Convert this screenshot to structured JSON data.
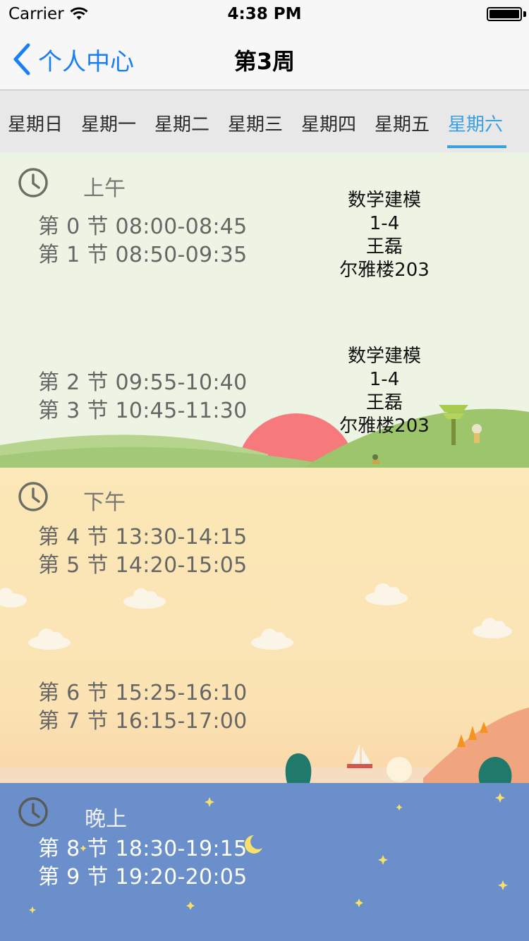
{
  "status_bar": {
    "carrier": "Carrier",
    "time": "4:38 PM",
    "battery_level": 1.0
  },
  "nav": {
    "back_label": "个人中心",
    "title": "第3周"
  },
  "day_tabs": [
    {
      "label": "星期日",
      "active": false
    },
    {
      "label": "星期一",
      "active": false
    },
    {
      "label": "星期二",
      "active": false
    },
    {
      "label": "星期三",
      "active": false
    },
    {
      "label": "星期四",
      "active": false
    },
    {
      "label": "星期五",
      "active": false
    },
    {
      "label": "星期六",
      "active": true
    }
  ],
  "colors": {
    "accent": "#3aa0de",
    "nav_link": "#1a80f2",
    "morning_bg": "#eef4e4",
    "afternoon_bg": "#fbe7b7",
    "evening_bg": "#6b8fca",
    "sun": "#f6797b"
  },
  "sections": {
    "morning": {
      "label": "上午",
      "icon": "clock-icon",
      "periods": [
        "第 0 节 08:00-08:45",
        "第 1 节 08:50-09:35",
        "第 2 节 09:55-10:40",
        "第 3 节 10:45-11:30"
      ],
      "courses": [
        {
          "name": "数学建模",
          "weeks": "1-4",
          "teacher": "王磊",
          "room": "尔雅楼203"
        },
        {
          "name": "数学建模",
          "weeks": "1-4",
          "teacher": "王磊",
          "room": "尔雅楼203"
        }
      ]
    },
    "afternoon": {
      "label": "下午",
      "icon": "clock-icon",
      "periods": [
        "第 4 节 13:30-14:15",
        "第 5 节 14:20-15:05",
        "第 6 节 15:25-16:10",
        "第 7 节 16:15-17:00"
      ]
    },
    "evening": {
      "label": "晚上",
      "icon": "clock-icon",
      "periods": [
        "第 8 节 18:30-19:15",
        "第 9 节 19:20-20:05"
      ]
    }
  }
}
